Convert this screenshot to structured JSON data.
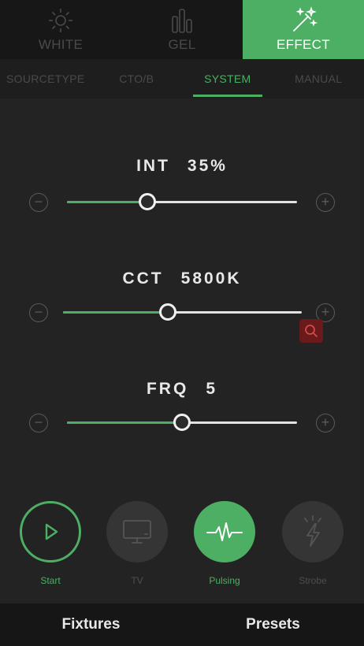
{
  "mode_tabs": [
    {
      "label": "WHITE",
      "icon": "sun-icon",
      "active": false
    },
    {
      "label": "GEL",
      "icon": "bars-icon",
      "active": false
    },
    {
      "label": "EFFECT",
      "icon": "magic-wand-icon",
      "active": true
    }
  ],
  "sub_tabs": [
    {
      "label": "SOURCETYPE",
      "active": false
    },
    {
      "label": "CTO/B",
      "active": false
    },
    {
      "label": "SYSTEM",
      "active": true
    },
    {
      "label": "MANUAL",
      "active": false
    }
  ],
  "params": {
    "int": {
      "name": "INT",
      "value": "35%",
      "level": 0.35
    },
    "cct": {
      "name": "CCT",
      "value": "5800K",
      "level": 0.44
    },
    "frq": {
      "name": "FRQ",
      "value": "5",
      "level": 0.5
    }
  },
  "effects": [
    {
      "label": "Start",
      "icon": "play-icon",
      "state": "outlined"
    },
    {
      "label": "TV",
      "icon": "tv-icon",
      "state": "inactive"
    },
    {
      "label": "Pulsing",
      "icon": "pulse-icon",
      "state": "active"
    },
    {
      "label": "Strobe",
      "icon": "strobe-icon",
      "state": "inactive"
    }
  ],
  "bottom_nav": [
    {
      "label": "Fixtures"
    },
    {
      "label": "Presets"
    }
  ],
  "colors": {
    "accent": "#4caf64",
    "background": "#232323",
    "inactive_text": "#4a4a4a"
  }
}
